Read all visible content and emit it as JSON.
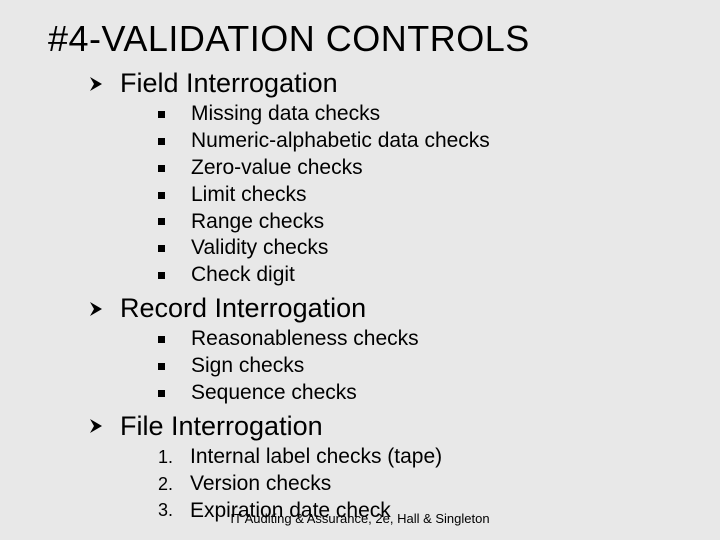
{
  "title": "#4-VALIDATION CONTROLS",
  "sections": [
    {
      "label": "Field Interrogation",
      "bullet_type": "square",
      "items": [
        "Missing data checks",
        "Numeric-alphabetic data checks",
        "Zero-value checks",
        "Limit checks",
        "Range checks",
        "Validity checks",
        "Check digit"
      ]
    },
    {
      "label": "Record Interrogation",
      "bullet_type": "square",
      "items": [
        "Reasonableness checks",
        "Sign checks",
        "Sequence checks"
      ]
    },
    {
      "label": "File Interrogation",
      "bullet_type": "number",
      "items": [
        "Internal label checks (tape)",
        "Version checks",
        "Expiration date check"
      ]
    }
  ],
  "footer": "IT Auditing & Assurance, 2e, Hall & Singleton"
}
